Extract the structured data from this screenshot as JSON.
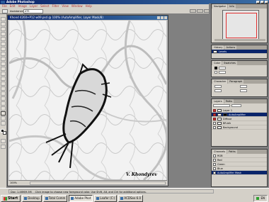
{
  "app": {
    "title": "Adobe Photoshop"
  },
  "menu": [
    "File",
    "Edit",
    "Image",
    "Layer",
    "Select",
    "Filter",
    "View",
    "Window",
    "Help"
  ],
  "options": {
    "label": "Assistance:",
    "value": "ATS Filenames"
  },
  "document": {
    "title": "Khond 4260+P12 w09.psd @ 100% (AutoAmplifier, Layer Mask/8)",
    "zoom": "100%",
    "signature": "V. Khondyrev"
  },
  "navigator": {
    "tabs": [
      "Navigator",
      "Info"
    ]
  },
  "history": {
    "tabs": [
      "History",
      "Actions"
    ],
    "items": [
      {
        "label": "Levels"
      }
    ]
  },
  "color_panel": {
    "tabs": [
      "Color",
      "Swatches"
    ]
  },
  "character_panel": {
    "tabs": [
      "Character",
      "Paragraph"
    ]
  },
  "layers": {
    "tabs": [
      "Layers",
      "Paths"
    ],
    "items": [
      {
        "label": "Layer 1",
        "selected": false
      },
      {
        "label": "AutoAmplifier",
        "selected": true
      },
      {
        "label": "Diffuse",
        "selected": false
      },
      {
        "label": "BR-blk",
        "selected": false
      },
      {
        "label": "Background",
        "selected": false
      }
    ]
  },
  "channels": {
    "tabs": [
      "Channels",
      "Paths"
    ],
    "items": [
      "RGB",
      "Red",
      "Green",
      "Blue",
      "AutoAmplifier Mask"
    ]
  },
  "status": {
    "doc": "Doc: 1.46M/9.5M",
    "hint": "Click image to choose new foreground color. Use Shift, Alt, and Ctrl for additional options."
  },
  "taskbar": {
    "start": "Start",
    "buttons": [
      {
        "label": "Desktop",
        "active": false
      },
      {
        "label": "Total Comm",
        "active": false
      },
      {
        "label": "Adobe Phot",
        "active": true
      },
      {
        "label": "Leafer (C:)",
        "active": false
      },
      {
        "label": "ACDSee 6.0",
        "active": false
      }
    ],
    "clock": "EN"
  },
  "colors": {
    "titlebar": "#0a246a",
    "selection": "#0a246a",
    "panel_bg": "#d4d0c8",
    "layer_eye": "#c83030"
  }
}
